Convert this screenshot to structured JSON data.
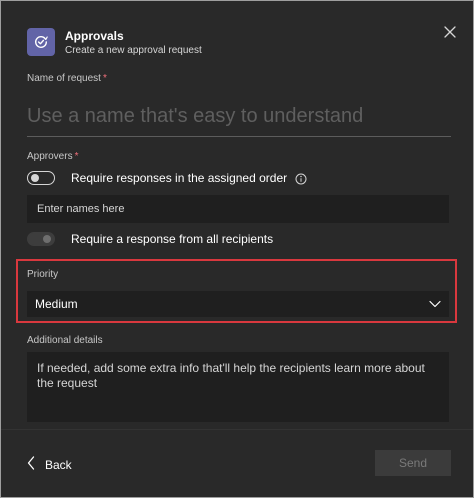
{
  "header": {
    "title": "Approvals",
    "subtitle": "Create a new approval request",
    "app_icon": "approvals-check-icon",
    "close_icon": "close-icon"
  },
  "name_of_request": {
    "label": "Name of request",
    "required_marker": "*",
    "placeholder": "Use a name that's easy to understand"
  },
  "approvers": {
    "label": "Approvers",
    "required_marker": "*",
    "assigned_order_toggle": {
      "label": "Require responses in the assigned order",
      "checked": false
    },
    "names_placeholder": "Enter names here",
    "all_recipients_toggle": {
      "label": "Require a response from all recipients",
      "checked": false,
      "disabled": true
    }
  },
  "priority": {
    "label": "Priority",
    "selected": "Medium",
    "highlight_color": "#d9383e"
  },
  "additional_details": {
    "label": "Additional details",
    "placeholder": "If needed, add some extra info that'll help the recipients learn more about the request"
  },
  "footer": {
    "back_label": "Back",
    "send_label": "Send"
  },
  "colors": {
    "background": "#292929",
    "accent": "#6264a7",
    "input_background": "#1f1f1f"
  }
}
